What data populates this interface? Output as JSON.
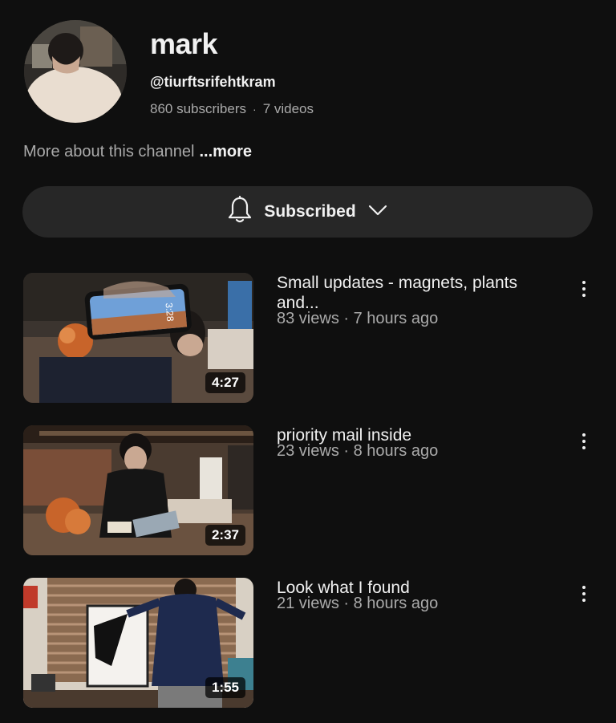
{
  "channel": {
    "name": "mark",
    "handle": "@tiurftsrifehtkram",
    "subscribers": "860 subscribers",
    "videos_count": "7 videos",
    "separator": "·",
    "about": "More about this channel",
    "more_label": "...more"
  },
  "subscribe": {
    "label": "Subscribed",
    "icons": [
      "bell-icon",
      "chevron-down-icon"
    ]
  },
  "videos": [
    {
      "title": "Small updates - magnets, plants and...",
      "views": "83 views · 7 hours ago",
      "duration": "4:27",
      "thumb_clock": "3:28"
    },
    {
      "title": "priority mail inside",
      "views": "23 views · 8 hours ago",
      "duration": "2:37"
    },
    {
      "title": "Look what I found",
      "views": "21 views · 8 hours ago",
      "duration": "1:55"
    }
  ],
  "colors": {
    "background": "#0f0f0f",
    "button": "#272727",
    "text_primary": "#f1f1f1",
    "text_secondary": "#aaaaaa"
  }
}
